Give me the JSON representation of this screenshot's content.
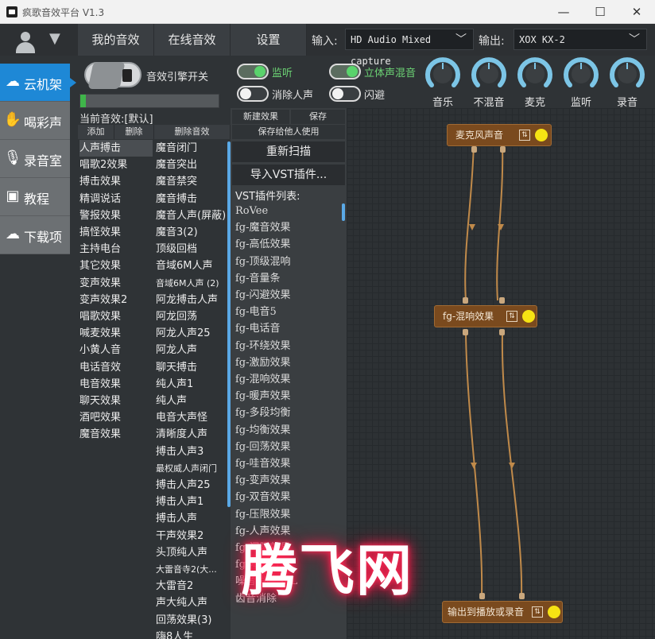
{
  "window": {
    "title": "疯歌音效平台 V1.3",
    "min": "—",
    "max": "☐",
    "close": "✕"
  },
  "nav": {
    "tabs": [
      "我的音效",
      "在线音效",
      "设置"
    ]
  },
  "io": {
    "input_label": "输入:",
    "input_value": "HD Audio Mixed capture",
    "output_label": "输出:",
    "output_value": "XOX KX-2"
  },
  "sidebar": {
    "items": [
      {
        "label": "云机架",
        "icon": "cloud-icon",
        "glyph": "☁",
        "active": true
      },
      {
        "label": "喝彩声",
        "icon": "clap-icon",
        "glyph": "✋",
        "active": false
      },
      {
        "label": "录音室",
        "icon": "microphone-icon",
        "glyph": "🎙",
        "active": false
      },
      {
        "label": "教程",
        "icon": "presentation-icon",
        "glyph": "▣",
        "active": false
      },
      {
        "label": "下载项",
        "icon": "cloud-download-icon",
        "glyph": "☁",
        "active": false
      }
    ]
  },
  "engine": {
    "label": "音效引擎开关",
    "level": 0.04
  },
  "toggles": [
    {
      "label": "监听",
      "on": true
    },
    {
      "label": "立体声混音",
      "on": true
    },
    {
      "label": "消除人声",
      "on": false
    },
    {
      "label": "闪避",
      "on": false
    }
  ],
  "knobs": [
    "音乐",
    "不混音",
    "麦克",
    "监听",
    "录音"
  ],
  "preset": {
    "title": "当前音效:[默认]",
    "buttons": [
      "添加",
      "删除",
      "删除音效"
    ],
    "categories": [
      "人声搏击",
      "唱歌2效果",
      "搏击效果",
      "精调说话",
      "警报效果",
      "搞怪效果",
      "主持电台",
      "其它效果",
      "变声效果",
      "变声效果2",
      "唱歌效果",
      "喊麦效果",
      "小黄人音",
      "电话音效",
      "电音效果",
      "聊天效果",
      "酒吧效果",
      "魔音效果"
    ],
    "presets": [
      "魔音闭门",
      "魔音突出",
      "魔音禁突",
      "魔音搏击",
      "魔音人声(屏蔽)",
      "魔音3(2)",
      "顶级回档",
      "音域6M人声",
      "音域6M人声 (2)",
      "阿龙搏击人声",
      "阿龙回荡",
      "阿龙人声25",
      "阿龙人声",
      "聊天搏击",
      "纯人声1",
      "纯人声",
      "电音大声怪",
      "清晰度人声",
      "搏击人声3",
      "最权威人声闭门",
      "搏击人声25",
      "搏击人声1",
      "搏击人声",
      "干声效果2",
      "头顶纯人声",
      "大雷音寺2(大...",
      "大雷音2",
      "声大纯人声",
      "回荡效果(3)",
      "嗨8人生"
    ]
  },
  "vst": {
    "buttons": [
      "新建效果",
      "保存",
      "保存给他人使用"
    ],
    "rescan": "重新扫描",
    "import": "导入VST插件...",
    "list_title": "VST插件列表:",
    "plugins": [
      "RoVee",
      "fg-魔音效果",
      "fg-高低效果",
      "fg-顶级混响",
      "fg-音量条",
      "fg-闪避效果",
      "fg-电音5",
      "fg-电话音",
      "fg-环绕效果",
      "fg-激励效果",
      "fg-混响效果",
      "fg-暖声效果",
      "fg-多段均衡",
      "fg-均衡效果",
      "fg-回荡效果",
      "fg-哇音效果",
      "fg-变声效果",
      "fg-双音效果",
      "fg-压限效果",
      "fg-人声效果",
      "fg-门限效果",
      "fg-降噪效果",
      "噪音消除SPL",
      "齿音消除"
    ]
  },
  "graph": {
    "nodes": [
      {
        "label": "麦克风声音",
        "mix": "⇅"
      },
      {
        "label": "fg-混响效果",
        "mix": "⇅"
      },
      {
        "label": "输出到播放或录音",
        "mix": "⇅"
      }
    ],
    "colors": {
      "node": "#7a4a1e",
      "wire": "#c08a4a",
      "dot": "#f6e313"
    }
  },
  "watermark": "腾飞网"
}
